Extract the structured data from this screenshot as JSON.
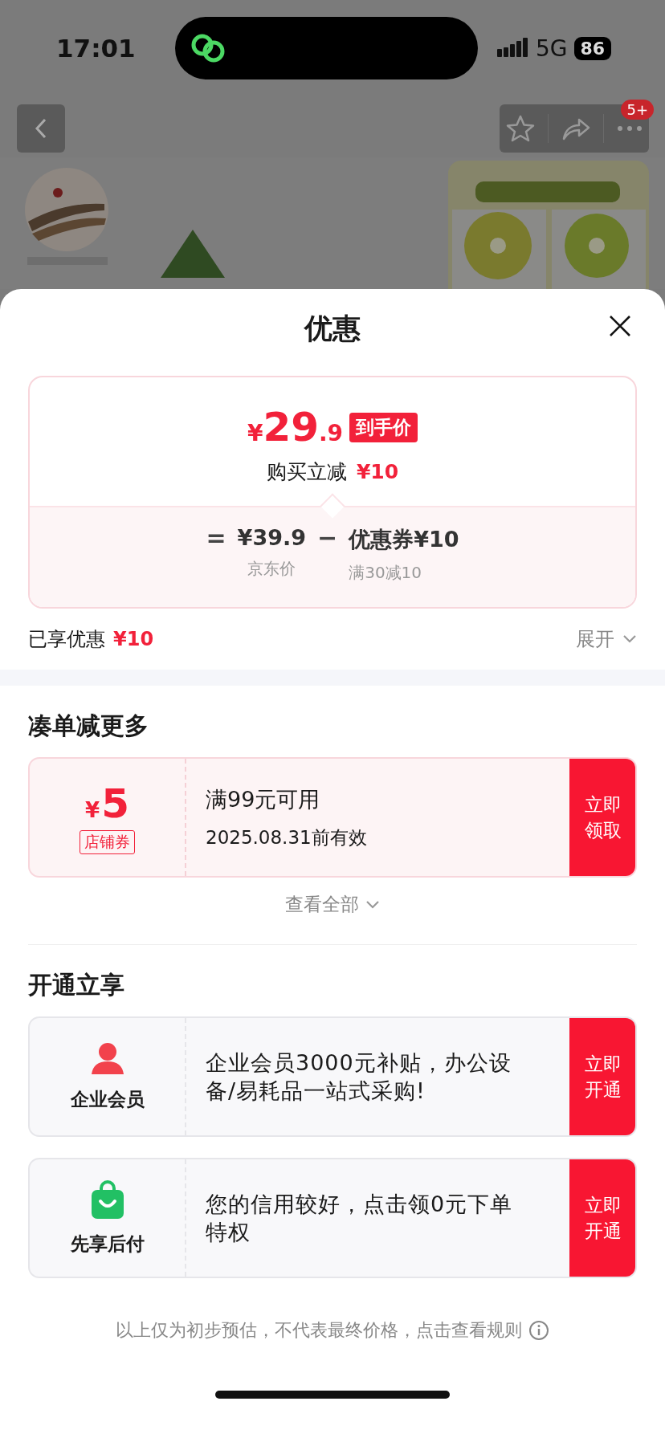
{
  "status_bar": {
    "time": "17:01",
    "network": "5G",
    "battery": "86"
  },
  "nav": {
    "badge": "5+"
  },
  "sheet": {
    "title": "优惠",
    "price_card": {
      "currency": "¥",
      "price_integer": "29",
      "price_decimal": ".9",
      "price_tag": "到手价",
      "saving_label": "购买立减",
      "saving_amount": "¥10",
      "breakdown": {
        "equals": "=",
        "list_price": "¥39.9",
        "list_price_label": "京东价",
        "minus": "−",
        "coupon": "优惠券¥10",
        "coupon_rule": "满30减10"
      }
    },
    "summary": {
      "label": "已享优惠",
      "amount": "¥10",
      "expand": "展开"
    },
    "coupon_section": {
      "title": "凑单减更多",
      "coupons": [
        {
          "currency": "¥",
          "amount": "5",
          "tag": "店铺券",
          "condition": "满99元可用",
          "validity": "2025.08.31前有效",
          "action": "立即领取"
        }
      ],
      "see_all": "查看全部"
    },
    "offer_section": {
      "title": "开通立享",
      "offers": [
        {
          "kind": "member",
          "name": "企业会员",
          "text": " 企业会员3000元补贴，办公设备/易耗品一站式采购!",
          "action": "立即开通"
        },
        {
          "kind": "paylater",
          "name": "先享后付",
          "text": "您的信用较好，点击领0元下单特权",
          "action": "立即开通"
        }
      ]
    },
    "footer": "以上仅为初步预估，不代表最终价格，点击查看规则"
  }
}
